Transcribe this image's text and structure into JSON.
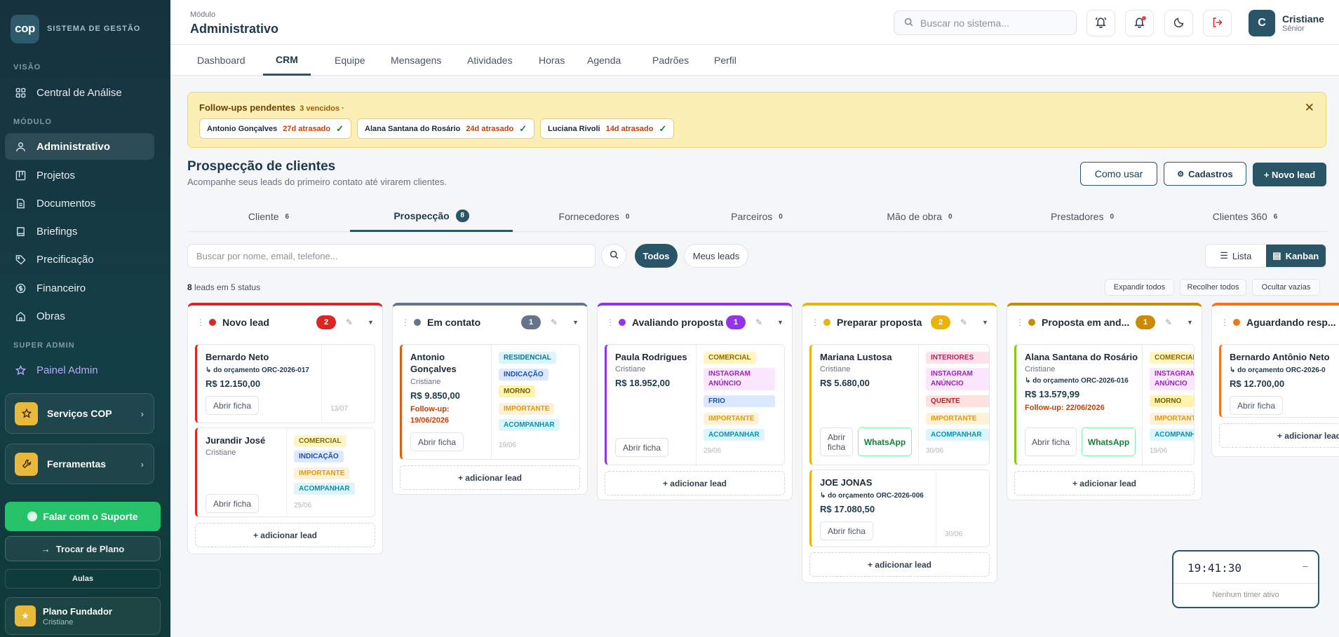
{
  "sidebar": {
    "logo": "cop",
    "brand": "SISTEMA DE GESTÃO",
    "sections": {
      "visao": "VISÃO",
      "modulo": "MÓDULO",
      "super_admin": "SUPER ADMIN"
    },
    "items": {
      "central": "Central de Análise",
      "administrativo": "Administrativo",
      "projetos": "Projetos",
      "documentos": "Documentos",
      "briefings": "Briefings",
      "precificacao": "Precificação",
      "financeiro": "Financeiro",
      "obras": "Obras",
      "painel_admin": "Painel Admin"
    },
    "servicos": "Serviços COP",
    "ferramentas": "Ferramentas",
    "support": "Falar com o Suporte",
    "switch_plan": "Trocar de Plano",
    "aulas": "Aulas",
    "plan_name": "Plano Fundador",
    "plan_user": "Cristiane"
  },
  "header": {
    "module_label": "Módulo",
    "module_title": "Administrativo",
    "search_placeholder": "Buscar no sistema...",
    "user_initial": "C",
    "user_name": "Cristiane",
    "user_role": "Sênior"
  },
  "tabs": [
    "Dashboard",
    "CRM",
    "Equipe",
    "Mensagens",
    "Atividades",
    "Horas",
    "Agenda",
    "Padrões",
    "Perfil"
  ],
  "followups": {
    "title": "Follow-ups pendentes",
    "count": "3 vencidos ·",
    "items": [
      {
        "name": "Antonio Gonçalves",
        "late": "27d atrasado"
      },
      {
        "name": "Alana Santana do Rosário",
        "late": "24d atrasado"
      },
      {
        "name": "Luciana Rivoli",
        "late": "14d atrasado"
      }
    ]
  },
  "page": {
    "title": "Prospecção de clientes",
    "subtitle": "Acompanhe seus leads do primeiro contato até virarem clientes.",
    "how_to": "Como usar",
    "cadastros": "Cadastros",
    "new_lead": "+ Novo lead"
  },
  "categories": [
    {
      "label": "Cliente",
      "count": "6"
    },
    {
      "label": "Prospecção",
      "count": "8"
    },
    {
      "label": "Fornecedores",
      "count": "0"
    },
    {
      "label": "Parceiros",
      "count": "0"
    },
    {
      "label": "Mão de obra",
      "count": "0"
    },
    {
      "label": "Prestadores",
      "count": "0"
    },
    {
      "label": "Clientes 360",
      "count": "6"
    }
  ],
  "filters": {
    "search_placeholder": "Buscar por nome, email, telefone...",
    "todos": "Todos",
    "meus": "Meus leads",
    "lista": "Lista",
    "kanban": "Kanban",
    "count_num": "8",
    "count_text": "leads em 5 status",
    "expand": "Expandir todos",
    "collapse": "Recolher todos",
    "hide_empty": "Ocultar vazias"
  },
  "kanban": {
    "add_lead": "+ adicionar lead",
    "open": "Abrir ficha",
    "whatsapp": "WhatsApp",
    "columns": [
      {
        "title": "Novo lead",
        "count": "2",
        "color": "#dc2626",
        "leads": [
          {
            "name": "Bernardo Neto",
            "orc": "↳ do orçamento ORC-2026-017",
            "value": "R$ 12.150,00",
            "date": "13/07"
          },
          {
            "name": "Jurandir José",
            "owner": "Cristiane",
            "tags": [
              "COMERCIAL",
              "INDICAÇÃO",
              "IMPORTANTE",
              "ACOMPANHAR"
            ],
            "date": "25/06"
          }
        ]
      },
      {
        "title": "Em contato",
        "count": "1",
        "color": "#64748b",
        "leads": [
          {
            "name": "Antonio Gonçalves",
            "owner": "Cristiane",
            "value": "R$ 9.850,00",
            "followup": "Follow-up: 19/06/2026",
            "tags": [
              "RESIDENCIAL",
              "INDICAÇÃO",
              "MORNO",
              "IMPORTANTE",
              "ACOMPANHAR"
            ],
            "date": "19/06"
          }
        ]
      },
      {
        "title": "Avaliando proposta",
        "count": "1",
        "color": "#9333ea",
        "leads": [
          {
            "name": "Paula Rodrigues",
            "owner": "Cristiane",
            "value": "R$ 18.952,00",
            "tags": [
              "COMERCIAL",
              "INSTAGRAM ANÚNCIO",
              "FRIO",
              "IMPORTANTE",
              "ACOMPANHAR"
            ],
            "date": "29/06"
          }
        ]
      },
      {
        "title": "Preparar proposta",
        "count": "2",
        "color": "#eab308",
        "leads": [
          {
            "name": "Mariana Lustosa",
            "owner": "Cristiane",
            "value": "R$ 5.680,00",
            "tags": [
              "INTERIORES",
              "INSTAGRAM ANÚNCIO",
              "QUENTE",
              "IMPORTANTE",
              "ACOMPANHAR"
            ],
            "date": "30/06"
          },
          {
            "name": "JOE JONAS",
            "orc": "↳ do orçamento ORC-2026-006",
            "value": "R$ 17.080,50",
            "date": "30/06"
          }
        ]
      },
      {
        "title": "Proposta em and...",
        "count": "1",
        "color": "#ca8a04",
        "leads": [
          {
            "name": "Alana Santana do Rosário",
            "owner": "Cristiane",
            "orc": "↳ do orçamento ORC-2026-016",
            "value": "R$ 13.579,99",
            "followup": "Follow-up: 22/06/2026",
            "tags": [
              "COMERCIAL",
              "INSTAGRAM ANÚNCIO",
              "MORNO",
              "IMPORTANTE",
              "ACOMPANHAR"
            ],
            "date": "19/06"
          }
        ]
      },
      {
        "title": "Aguardando resp...",
        "color": "#f97316",
        "leads": [
          {
            "name": "Bernardo Antônio Neto",
            "orc": "↳ do orçamento ORC-2026-0",
            "value": "R$ 12.700,00"
          }
        ]
      }
    ]
  },
  "timer": {
    "time": "19:41:30",
    "status": "Nenhum timer ativo"
  }
}
